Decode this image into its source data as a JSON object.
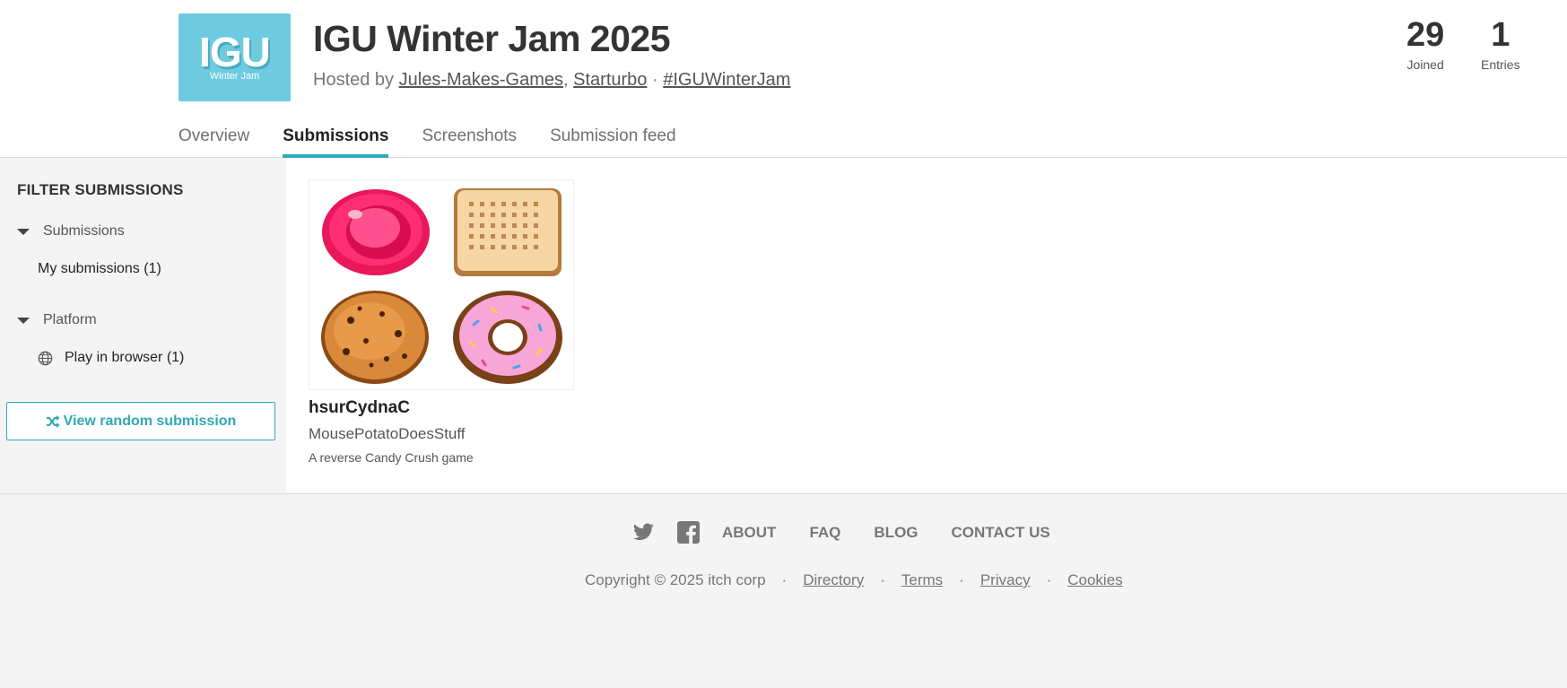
{
  "jam": {
    "logo_text": "IGU",
    "logo_subtext": "Winter Jam",
    "title": "IGU Winter Jam 2025",
    "hosted_by_label": "Hosted by",
    "hosts": [
      "Jules-Makes-Games",
      "Starturbo"
    ],
    "separator": "·",
    "hashtag": "#IGUWinterJam",
    "stats": [
      {
        "value": "29",
        "label": "Joined"
      },
      {
        "value": "1",
        "label": "Entries"
      }
    ]
  },
  "tabs": [
    {
      "label": "Overview",
      "active": false
    },
    {
      "label": "Submissions",
      "active": true
    },
    {
      "label": "Screenshots",
      "active": false
    },
    {
      "label": "Submission feed",
      "active": false
    }
  ],
  "sidebar": {
    "title": "FILTER SUBMISSIONS",
    "groups": [
      {
        "label": "Submissions",
        "items": [
          {
            "label": "My submissions (1)",
            "icon": ""
          }
        ]
      },
      {
        "label": "Platform",
        "items": [
          {
            "label": "Play in browser (1)",
            "icon": "globe-icon"
          }
        ]
      }
    ],
    "random_button": "View random submission",
    "random_icon": "shuffle-icon"
  },
  "submissions": [
    {
      "title": "hsurCydnaC",
      "author": "MousePotatoDoesStuff",
      "description": "A reverse Candy Crush game",
      "thumbnail_items": [
        "red-candy",
        "biscuit",
        "cookie",
        "donut"
      ]
    }
  ],
  "footer": {
    "social_icons": [
      "twitter-icon",
      "facebook-icon"
    ],
    "links": [
      "ABOUT",
      "FAQ",
      "BLOG",
      "CONTACT US"
    ],
    "copyright": "Copyright © 2025 itch corp",
    "bottom_links": [
      "Directory",
      "Terms",
      "Privacy",
      "Cookies"
    ]
  },
  "colors": {
    "accent": "#30a8b8",
    "logo_bg": "#6ecbdf",
    "page_bg": "#f4f4f4"
  }
}
